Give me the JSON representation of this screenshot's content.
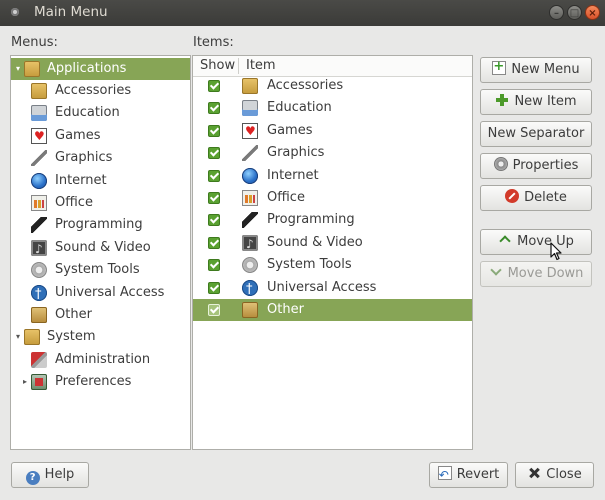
{
  "window": {
    "title": "Main Menu",
    "controls": [
      "minimize",
      "maximize",
      "close"
    ]
  },
  "menus_label": "Menus:",
  "items_label": "Items:",
  "menus_tree": [
    {
      "label": "Applications",
      "icon": "applications-folder-icon",
      "expander": "▾",
      "selected": true
    },
    {
      "label": "Accessories",
      "icon": "accessories-icon"
    },
    {
      "label": "Education",
      "icon": "education-icon"
    },
    {
      "label": "Games",
      "icon": "games-icon"
    },
    {
      "label": "Graphics",
      "icon": "graphics-icon"
    },
    {
      "label": "Internet",
      "icon": "internet-icon"
    },
    {
      "label": "Office",
      "icon": "office-icon"
    },
    {
      "label": "Programming",
      "icon": "programming-icon"
    },
    {
      "label": "Sound & Video",
      "icon": "sound-video-icon"
    },
    {
      "label": "System Tools",
      "icon": "system-tools-icon"
    },
    {
      "label": "Universal Access",
      "icon": "universal-access-icon"
    },
    {
      "label": "Other",
      "icon": "other-icon"
    },
    {
      "label": "System",
      "icon": "system-folder-icon",
      "expander": "▾"
    },
    {
      "label": "Administration",
      "icon": "administration-icon"
    },
    {
      "label": "Preferences",
      "icon": "preferences-icon",
      "expander": "▸"
    }
  ],
  "items_list": {
    "columns": [
      "Show",
      "Item"
    ],
    "rows": [
      {
        "label": "Accessories",
        "checked": true
      },
      {
        "label": "Education",
        "checked": true
      },
      {
        "label": "Games",
        "checked": true
      },
      {
        "label": "Graphics",
        "checked": true
      },
      {
        "label": "Internet",
        "checked": true
      },
      {
        "label": "Office",
        "checked": true
      },
      {
        "label": "Programming",
        "checked": true
      },
      {
        "label": "Sound & Video",
        "checked": true
      },
      {
        "label": "System Tools",
        "checked": true
      },
      {
        "label": "Universal Access",
        "checked": true
      },
      {
        "label": "Other",
        "checked": true,
        "selected": true
      }
    ]
  },
  "actions": {
    "new_menu": "New Menu",
    "new_item": "New Item",
    "new_separator": "New Separator",
    "properties": "Properties",
    "delete": "Delete",
    "move_up": "Move Up",
    "move_down": "Move Down"
  },
  "footer": {
    "help": "Help",
    "revert": "Revert",
    "close": "Close"
  },
  "colors": {
    "selection": "#87a556",
    "checkbox": "#5aa131",
    "titlebar": "#3b3b38",
    "close_button": "#d8512a"
  }
}
